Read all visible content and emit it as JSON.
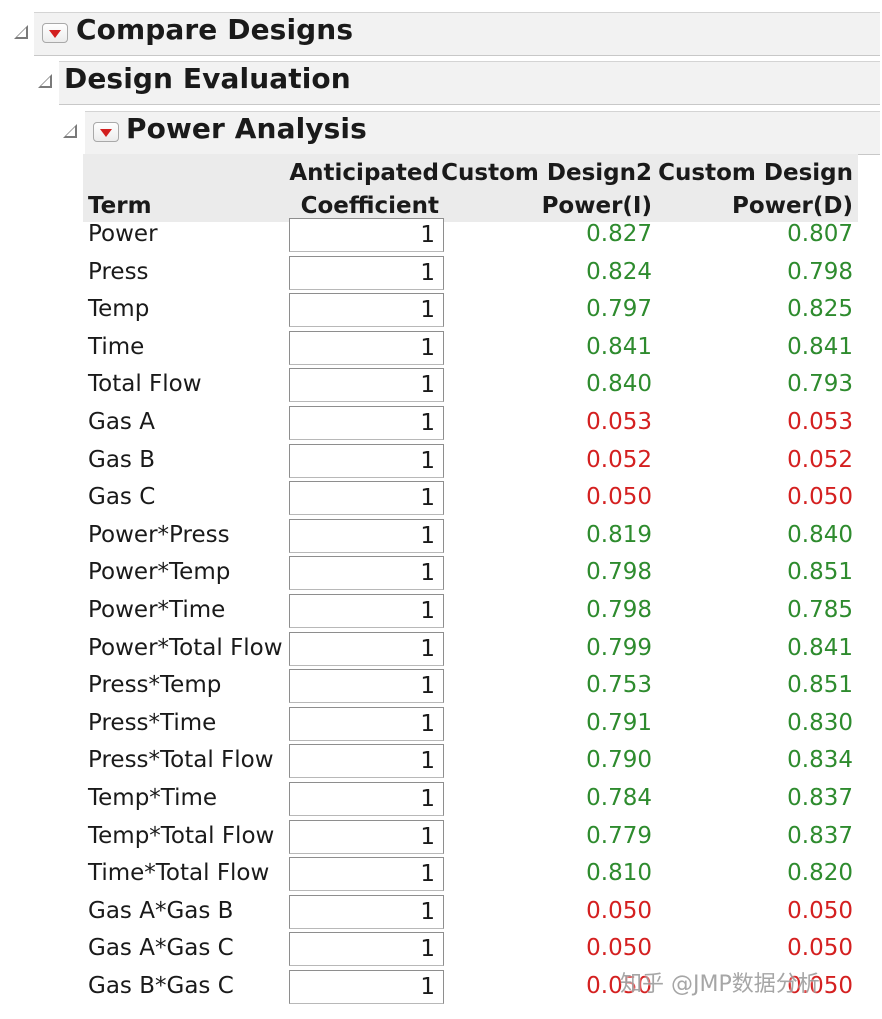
{
  "outline": {
    "compare_designs": "Compare Designs",
    "design_evaluation": "Design Evaluation",
    "power_analysis": "Power Analysis"
  },
  "table": {
    "headers": {
      "term": "Term",
      "coef_line1": "Anticipated",
      "coef_line2": "Coefficient",
      "d2_line1": "Custom Design2",
      "d2_line2": "Power(I)",
      "d1_line1": "Custom Design",
      "d1_line2": "Power(D)"
    },
    "rows": [
      {
        "term": "Power",
        "coef": "1",
        "p1": "0.827",
        "p1_low": false,
        "p2": "0.807",
        "p2_low": false
      },
      {
        "term": "Press",
        "coef": "1",
        "p1": "0.824",
        "p1_low": false,
        "p2": "0.798",
        "p2_low": false
      },
      {
        "term": "Temp",
        "coef": "1",
        "p1": "0.797",
        "p1_low": false,
        "p2": "0.825",
        "p2_low": false
      },
      {
        "term": "Time",
        "coef": "1",
        "p1": "0.841",
        "p1_low": false,
        "p2": "0.841",
        "p2_low": false
      },
      {
        "term": "Total Flow",
        "coef": "1",
        "p1": "0.840",
        "p1_low": false,
        "p2": "0.793",
        "p2_low": false
      },
      {
        "term": "Gas A",
        "coef": "1",
        "p1": "0.053",
        "p1_low": true,
        "p2": "0.053",
        "p2_low": true
      },
      {
        "term": "Gas B",
        "coef": "1",
        "p1": "0.052",
        "p1_low": true,
        "p2": "0.052",
        "p2_low": true
      },
      {
        "term": "Gas C",
        "coef": "1",
        "p1": "0.050",
        "p1_low": true,
        "p2": "0.050",
        "p2_low": true
      },
      {
        "term": "Power*Press",
        "coef": "1",
        "p1": "0.819",
        "p1_low": false,
        "p2": "0.840",
        "p2_low": false
      },
      {
        "term": "Power*Temp",
        "coef": "1",
        "p1": "0.798",
        "p1_low": false,
        "p2": "0.851",
        "p2_low": false
      },
      {
        "term": "Power*Time",
        "coef": "1",
        "p1": "0.798",
        "p1_low": false,
        "p2": "0.785",
        "p2_low": false
      },
      {
        "term": "Power*Total Flow",
        "coef": "1",
        "p1": "0.799",
        "p1_low": false,
        "p2": "0.841",
        "p2_low": false
      },
      {
        "term": "Press*Temp",
        "coef": "1",
        "p1": "0.753",
        "p1_low": false,
        "p2": "0.851",
        "p2_low": false
      },
      {
        "term": "Press*Time",
        "coef": "1",
        "p1": "0.791",
        "p1_low": false,
        "p2": "0.830",
        "p2_low": false
      },
      {
        "term": "Press*Total Flow",
        "coef": "1",
        "p1": "0.790",
        "p1_low": false,
        "p2": "0.834",
        "p2_low": false
      },
      {
        "term": "Temp*Time",
        "coef": "1",
        "p1": "0.784",
        "p1_low": false,
        "p2": "0.837",
        "p2_low": false
      },
      {
        "term": "Temp*Total Flow",
        "coef": "1",
        "p1": "0.779",
        "p1_low": false,
        "p2": "0.837",
        "p2_low": false
      },
      {
        "term": "Time*Total Flow",
        "coef": "1",
        "p1": "0.810",
        "p1_low": false,
        "p2": "0.820",
        "p2_low": false
      },
      {
        "term": "Gas A*Gas B",
        "coef": "1",
        "p1": "0.050",
        "p1_low": true,
        "p2": "0.050",
        "p2_low": true
      },
      {
        "term": "Gas A*Gas C",
        "coef": "1",
        "p1": "0.050",
        "p1_low": true,
        "p2": "0.050",
        "p2_low": true
      },
      {
        "term": "Gas B*Gas C",
        "coef": "1",
        "p1": "0.050",
        "p1_low": true,
        "p2": "0.050",
        "p2_low": true
      }
    ]
  },
  "colors": {
    "adequate_power": "#2e8b2e",
    "low_power": "#d42020",
    "outline_bar": "#f2f2f2"
  },
  "icons": {
    "disclosure": "disclosure-open-icon",
    "menu": "red-triangle-menu-icon"
  },
  "watermark": "知乎 @JMP数据分析"
}
